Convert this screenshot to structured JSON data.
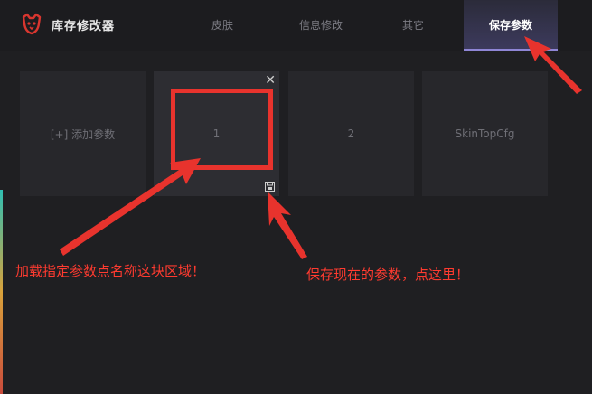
{
  "header": {
    "title": "库存修改器",
    "tabs": [
      {
        "label": "皮肤",
        "active": false
      },
      {
        "label": "信息修改",
        "active": false
      },
      {
        "label": "其它",
        "active": false
      },
      {
        "label": "保存参数",
        "active": true
      }
    ]
  },
  "params": {
    "add_label": "[+] 添加参数",
    "items": [
      "1",
      "2",
      "SkinTopCfg"
    ]
  },
  "annotations": {
    "load_hint": "加载指定参数点名称这块区域！",
    "save_hint": "保存现在的参数，点这里！"
  },
  "colors": {
    "accent": "#8f86d6",
    "annotation": "#e8332d",
    "background": "#1f1f22"
  }
}
